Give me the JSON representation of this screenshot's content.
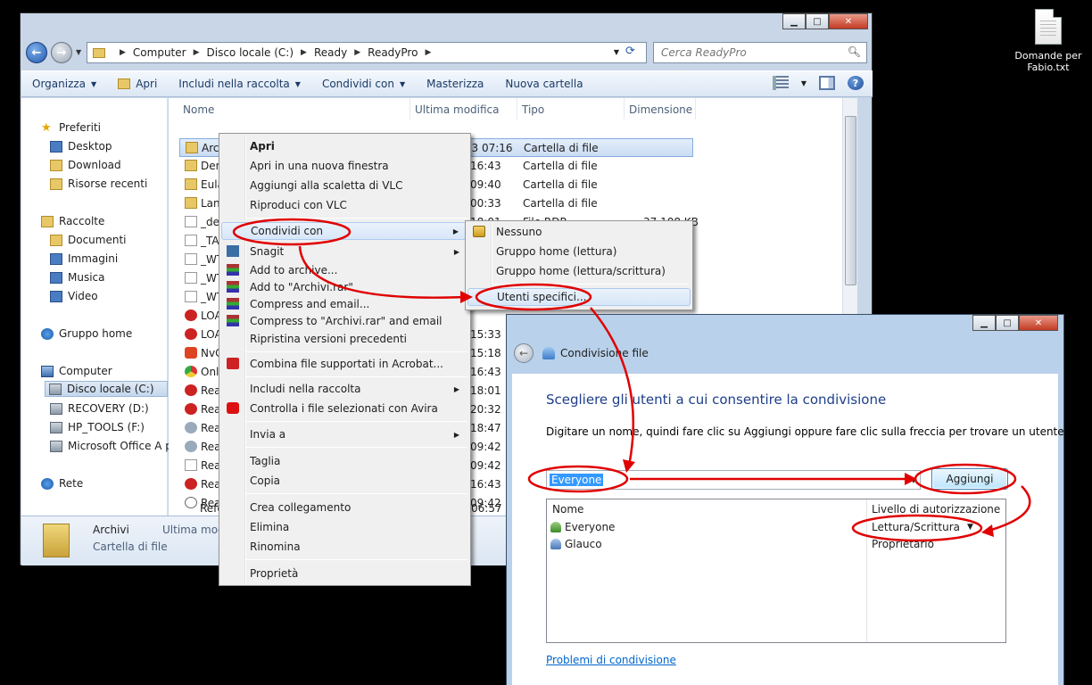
{
  "desktop": {
    "file_label": "Domande per Fabio.txt"
  },
  "explorer": {
    "controls": {
      "min": "▁",
      "max": "□",
      "close": "✕"
    },
    "address": {
      "crumbs": [
        "Computer",
        "Disco locale (C:)",
        "Ready",
        "ReadyPro"
      ]
    },
    "search": {
      "placeholder": "Cerca ReadyPro"
    },
    "toolbar": {
      "organizza": "Organizza",
      "apri": "Apri",
      "includi": "Includi nella raccolta",
      "condividi": "Condividi con",
      "masterizza": "Masterizza",
      "nuova_cartella": "Nuova cartella"
    },
    "nav": {
      "preferiti": "Preferiti",
      "desktop": "Desktop",
      "download": "Download",
      "risorse_recenti": "Risorse recenti",
      "raccolte": "Raccolte",
      "documenti": "Documenti",
      "immagini": "Immagini",
      "musica": "Musica",
      "video": "Video",
      "gruppo_home": "Gruppo home",
      "computer": "Computer",
      "disco_c": "Disco locale (C:)",
      "recovery": "RECOVERY (D:)",
      "hp_tools": "HP_TOOLS (F:)",
      "office": "Microsoft Office A p",
      "rete": "Rete"
    },
    "columns": {
      "nome": "Nome",
      "modifica": "Ultima modifica",
      "tipo": "Tipo",
      "dimensione": "Dimensione"
    },
    "rows": [
      {
        "name": "Archivi",
        "date": "01/04/2013 07:16",
        "type": "Cartella di file",
        "size": ""
      },
      {
        "name": "Dem",
        "date": "16:43",
        "type": "Cartella di file",
        "size": ""
      },
      {
        "name": "Eula",
        "date": "09:40",
        "type": "Cartella di file",
        "size": ""
      },
      {
        "name": "Lan",
        "date": "00:33",
        "type": "Cartella di file",
        "size": ""
      },
      {
        "name": "_def",
        "date": "18:01",
        "type": "File RDR",
        "size": "37.108 KB"
      },
      {
        "name": "_TA",
        "date": "",
        "type": "",
        "size": ""
      },
      {
        "name": "_WT",
        "date": "",
        "type": "",
        "size": ""
      },
      {
        "name": "_WT",
        "date": "",
        "type": "",
        "size": ""
      },
      {
        "name": "_WT",
        "date": "",
        "type": "",
        "size": ""
      },
      {
        "name": "LOA",
        "date": "",
        "type": "",
        "size": ""
      },
      {
        "name": "LOA",
        "date": "15:33",
        "type": "",
        "size": ""
      },
      {
        "name": "NvC",
        "date": "15:18",
        "type": "",
        "size": ""
      },
      {
        "name": "Onl",
        "date": "16:43",
        "type": "",
        "size": ""
      },
      {
        "name": "Rea",
        "date": "18:01",
        "type": "",
        "size": ""
      },
      {
        "name": "Rea",
        "date": "20:32",
        "type": "",
        "size": ""
      },
      {
        "name": "Rea",
        "date": "18:47",
        "type": "",
        "size": ""
      },
      {
        "name": "Rea",
        "date": "09:42",
        "type": "",
        "size": ""
      },
      {
        "name": "Rea",
        "date": "09:42",
        "type": "",
        "size": ""
      },
      {
        "name": "Rea",
        "date": "16:43",
        "type": "",
        "size": ""
      },
      {
        "name": "Rea",
        "date": "09:42",
        "type": "",
        "size": ""
      },
      {
        "name": "Refe",
        "date": "06:57",
        "type": "",
        "size": ""
      }
    ],
    "details": {
      "name": "Archivi",
      "type": "Cartella di file",
      "modified_label": "Ultima mod"
    }
  },
  "context_menu": {
    "apri": "Apri",
    "nuova_finestra": "Apri in una nuova finestra",
    "scaletta_vlc": "Aggiungi alla scaletta di VLC",
    "riproduci_vlc": "Riproduci con VLC",
    "condividi": "Condividi con",
    "snagit": "Snagit",
    "add_archive": "Add to archive...",
    "add_rar": "Add to \"Archivi.rar\"",
    "compress_email": "Compress and email...",
    "compress_rar_email": "Compress to \"Archivi.rar\" and email",
    "ripristina": "Ripristina versioni precedenti",
    "acrobat": "Combina file supportati in Acrobat...",
    "includi": "Includi nella raccolta",
    "avira": "Controlla i file selezionati con Avira",
    "invia": "Invia a",
    "taglia": "Taglia",
    "copia": "Copia",
    "crea_collegamento": "Crea collegamento",
    "elimina": "Elimina",
    "rinomina": "Rinomina",
    "proprieta": "Proprietà"
  },
  "share_submenu": {
    "nessuno": "Nessuno",
    "gruppo_lettura": "Gruppo home (lettura)",
    "gruppo_scrittura": "Gruppo home (lettura/scrittura)",
    "utenti": "Utenti specifici..."
  },
  "share_dialog": {
    "window_title": "Condivisione file",
    "heading": "Scegliere gli utenti a cui consentire la condivisione",
    "description": "Digitare un nome, quindi fare clic su Aggiungi oppure fare clic sulla freccia per trovare un utente.",
    "combo_value": "Everyone",
    "add_button": "Aggiungi",
    "col_name": "Nome",
    "col_perm": "Livello di autorizzazione",
    "users": [
      {
        "name": "Everyone",
        "perm": "Lettura/Scrittura"
      },
      {
        "name": "Glauco",
        "perm": "Proprietario"
      }
    ],
    "help_link": "Problemi di condivisione"
  },
  "colors": {
    "annotation": "#e00000",
    "selection": "#3399ff",
    "link": "#0066cc"
  }
}
